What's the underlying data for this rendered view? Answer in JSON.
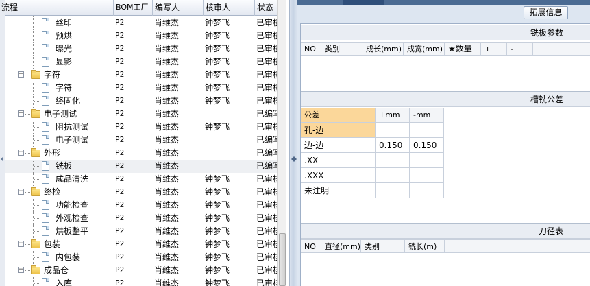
{
  "tree_grid": {
    "columns": [
      "流程",
      "BOM工厂",
      "编写人",
      "核审人",
      "状态"
    ],
    "rows": [
      {
        "name": "丝印",
        "type": "doc",
        "level": 2,
        "bom": "P2",
        "writer": "肖维杰",
        "reviewer": "钟梦飞",
        "status": "已审核"
      },
      {
        "name": "预烘",
        "type": "doc",
        "level": 2,
        "bom": "P2",
        "writer": "肖维杰",
        "reviewer": "钟梦飞",
        "status": "已审核"
      },
      {
        "name": "曝光",
        "type": "doc",
        "level": 2,
        "bom": "P2",
        "writer": "肖维杰",
        "reviewer": "钟梦飞",
        "status": "已审核"
      },
      {
        "name": "显影",
        "type": "doc",
        "level": 2,
        "bom": "P2",
        "writer": "肖维杰",
        "reviewer": "钟梦飞",
        "status": "已审核"
      },
      {
        "name": "字符",
        "type": "folder",
        "level": 1,
        "bom": "P2",
        "writer": "肖维杰",
        "reviewer": "钟梦飞",
        "status": "已审核"
      },
      {
        "name": "字符",
        "type": "doc",
        "level": 2,
        "bom": "P2",
        "writer": "肖维杰",
        "reviewer": "钟梦飞",
        "status": "已审核"
      },
      {
        "name": "终固化",
        "type": "doc",
        "level": 2,
        "bom": "P2",
        "writer": "肖维杰",
        "reviewer": "钟梦飞",
        "status": "已审核"
      },
      {
        "name": "电子测试",
        "type": "folder",
        "level": 1,
        "bom": "P2",
        "writer": "肖维杰",
        "reviewer": "",
        "status": "已编写"
      },
      {
        "name": "阻抗测试",
        "type": "doc",
        "level": 2,
        "bom": "P2",
        "writer": "肖维杰",
        "reviewer": "钟梦飞",
        "status": "已审核"
      },
      {
        "name": "电子测试",
        "type": "doc",
        "level": 2,
        "bom": "P2",
        "writer": "肖维杰",
        "reviewer": "",
        "status": "已编写"
      },
      {
        "name": "外形",
        "type": "folder",
        "level": 1,
        "bom": "P2",
        "writer": "肖维杰",
        "reviewer": "",
        "status": "已编写"
      },
      {
        "name": "铣板",
        "type": "doc",
        "level": 2,
        "bom": "P2",
        "writer": "肖维杰",
        "reviewer": "",
        "status": "已编写",
        "selected": true
      },
      {
        "name": "成品清洗",
        "type": "doc",
        "level": 2,
        "bom": "P2",
        "writer": "肖维杰",
        "reviewer": "钟梦飞",
        "status": "已审核"
      },
      {
        "name": "终检",
        "type": "folder",
        "level": 1,
        "bom": "P2",
        "writer": "肖维杰",
        "reviewer": "钟梦飞",
        "status": "已审核"
      },
      {
        "name": "功能检查",
        "type": "doc",
        "level": 2,
        "bom": "P2",
        "writer": "肖维杰",
        "reviewer": "钟梦飞",
        "status": "已审核"
      },
      {
        "name": "外观检查",
        "type": "doc",
        "level": 2,
        "bom": "P2",
        "writer": "肖维杰",
        "reviewer": "钟梦飞",
        "status": "已审核"
      },
      {
        "name": "烘板整平",
        "type": "doc",
        "level": 2,
        "bom": "P2",
        "writer": "肖维杰",
        "reviewer": "钟梦飞",
        "status": "已审核"
      },
      {
        "name": "包装",
        "type": "folder",
        "level": 1,
        "bom": "P2",
        "writer": "肖维杰",
        "reviewer": "钟梦飞",
        "status": "已审核"
      },
      {
        "name": "内包装",
        "type": "doc",
        "level": 2,
        "bom": "P2",
        "writer": "肖维杰",
        "reviewer": "钟梦飞",
        "status": "已审核"
      },
      {
        "name": "成品仓",
        "type": "folder",
        "level": 1,
        "bom": "P2",
        "writer": "肖维杰",
        "reviewer": "钟梦飞",
        "status": "已审核"
      },
      {
        "name": "入库",
        "type": "doc",
        "level": 2,
        "bom": "P2",
        "writer": "肖维杰",
        "reviewer": "钟梦飞",
        "status": "已审核"
      }
    ]
  },
  "right_panel": {
    "expand_button_label": "拓展信息",
    "milling_params": {
      "title": "铣板参数",
      "columns": [
        "NO",
        "类别",
        "成长(mm)",
        "成宽(mm)",
        "★数量",
        "+",
        "-"
      ]
    },
    "milling_tolerance": {
      "title": "槽铣公差",
      "header": [
        "公差",
        "+mm",
        "-mm"
      ],
      "rows": [
        {
          "label": "孔-边",
          "plus": "",
          "minus": ""
        },
        {
          "label": "边-边",
          "plus": "0.150",
          "minus": "0.150"
        },
        {
          "label": ".XX",
          "plus": "",
          "minus": ""
        },
        {
          "label": ".XXX",
          "plus": "",
          "minus": ""
        },
        {
          "label": "未注明",
          "plus": "",
          "minus": ""
        }
      ]
    },
    "tool_table": {
      "title": "刀径表",
      "columns": [
        "NO",
        "直径(mm)",
        "类别",
        "铣长(m)"
      ]
    }
  }
}
